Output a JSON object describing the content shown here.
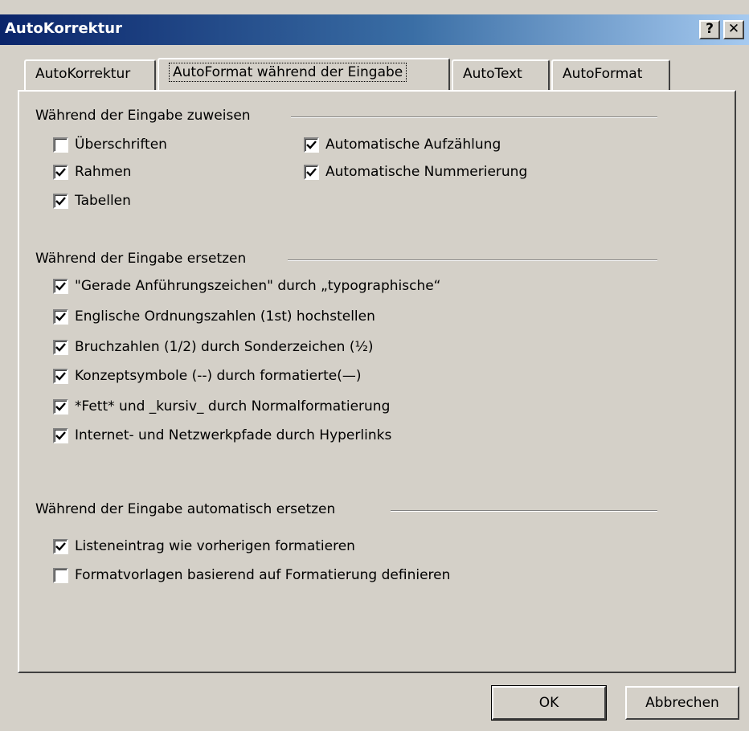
{
  "window": {
    "title": "AutoKorrektur",
    "help_label": "?",
    "close_label": "✕"
  },
  "tabs": [
    {
      "label": "AutoKorrektur",
      "active": false
    },
    {
      "label": "AutoFormat während der Eingabe",
      "active": true
    },
    {
      "label": "AutoText",
      "active": false
    },
    {
      "label": "AutoFormat",
      "active": false
    }
  ],
  "group_apply": {
    "title": "Während der Eingabe zuweisen",
    "items": [
      {
        "label": "Überschriften",
        "checked": false
      },
      {
        "label": "Rahmen",
        "checked": true
      },
      {
        "label": "Tabellen",
        "checked": true
      },
      {
        "label": "Automatische Aufzählung",
        "checked": true
      },
      {
        "label": "Automatische Nummerierung",
        "checked": true
      }
    ]
  },
  "group_replace": {
    "title": "Während der Eingabe ersetzen",
    "items": [
      {
        "label": "\"Gerade Anführungszeichen\" durch „typographische“",
        "checked": true
      },
      {
        "label": "Englische Ordnungszahlen (1st) hochstellen",
        "checked": true
      },
      {
        "label": "Bruchzahlen (1/2) durch Sonderzeichen (½)",
        "checked": true
      },
      {
        "label": "Konzeptsymbole (--) durch formatierte(—)",
        "checked": true
      },
      {
        "label": "*Fett* und _kursiv_ durch Normalformatierung",
        "checked": true
      },
      {
        "label": "Internet- und Netzwerkpfade durch Hyperlinks",
        "checked": true
      }
    ]
  },
  "group_auto": {
    "title": "Während der Eingabe automatisch ersetzen",
    "items": [
      {
        "label": "Listeneintrag wie vorherigen formatieren",
        "checked": true
      },
      {
        "label": "Formatvorlagen basierend auf Formatierung definieren",
        "checked": false
      }
    ]
  },
  "buttons": {
    "ok": "OK",
    "cancel": "Abbrechen"
  }
}
